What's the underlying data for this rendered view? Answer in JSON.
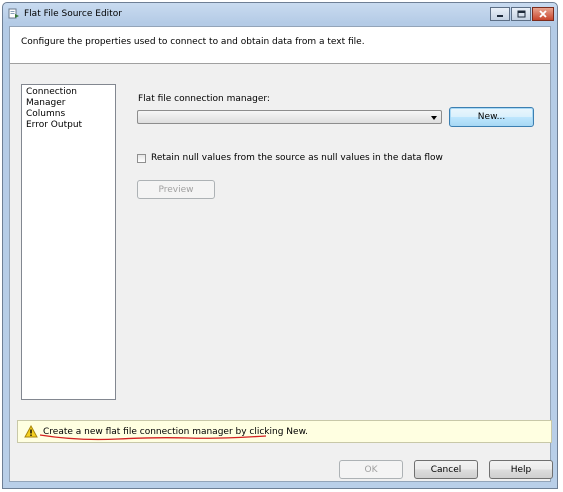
{
  "window": {
    "title": "Flat File Source Editor",
    "controls": [
      "minimize-icon",
      "maximize-icon",
      "close-icon"
    ]
  },
  "header": {
    "description": "Configure the properties used to connect to and obtain data from a text file."
  },
  "nav": {
    "items": [
      {
        "label": "Connection Manager"
      },
      {
        "label": "Columns"
      },
      {
        "label": "Error Output"
      }
    ]
  },
  "connection": {
    "label": "Flat file connection manager:",
    "selected_value": "",
    "new_button": "New..."
  },
  "retain_nulls": {
    "label": "Retain null values from the source as null values in the data flow",
    "checked": false
  },
  "preview_button": "Preview",
  "info": {
    "message": "Create a new flat file connection manager by clicking New.",
    "icon": "warning-icon",
    "annotation_color": "#d42020"
  },
  "footer": {
    "ok": "OK",
    "cancel": "Cancel",
    "help": "Help"
  }
}
